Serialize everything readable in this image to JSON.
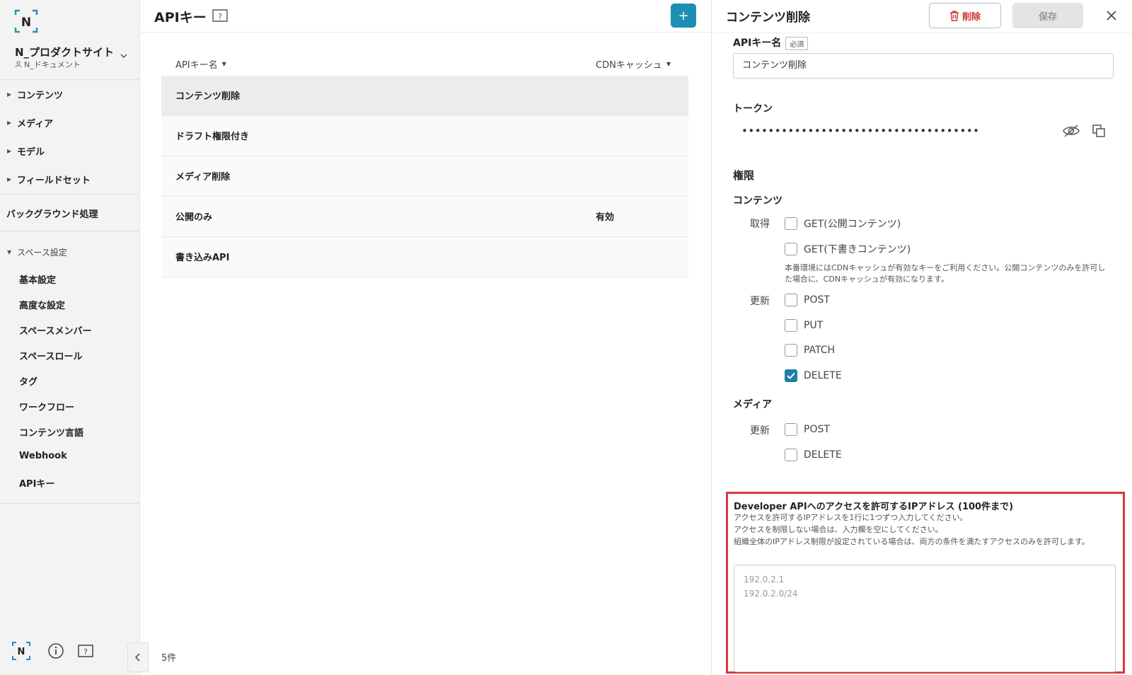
{
  "sidebar": {
    "logo_letter": "N",
    "space_name": "N_プロダクトサイト",
    "space_sub": "N_ドキュメント",
    "nav": [
      {
        "label": "コンテンツ"
      },
      {
        "label": "メディア"
      },
      {
        "label": "モデル"
      },
      {
        "label": "フィールドセット"
      }
    ],
    "background": "バックグラウンド処理",
    "settings_section": "スペース設定",
    "settings": [
      {
        "label": "基本設定"
      },
      {
        "label": "高度な設定"
      },
      {
        "label": "スペースメンバー"
      },
      {
        "label": "スペースロール"
      },
      {
        "label": "タグ"
      },
      {
        "label": "ワークフロー"
      },
      {
        "label": "コンテンツ言語"
      },
      {
        "label": "Webhook"
      },
      {
        "label": "APIキー"
      }
    ]
  },
  "main": {
    "title": "APIキー",
    "add_label": "+",
    "columns": {
      "name": "APIキー名",
      "cdn": "CDNキャッシュ"
    },
    "rows": [
      {
        "name": "コンテンツ削除",
        "cdn": ""
      },
      {
        "name": "ドラフト権限付き",
        "cdn": ""
      },
      {
        "name": "メディア削除",
        "cdn": ""
      },
      {
        "name": "公開のみ",
        "cdn": "有効"
      },
      {
        "name": "書き込みAPI",
        "cdn": ""
      }
    ],
    "count": "5件"
  },
  "panel": {
    "title": "コンテンツ削除",
    "delete_label": "削除",
    "save_label": "保存",
    "name_label": "APIキー名",
    "required_badge": "必須",
    "name_value": "コンテンツ削除",
    "token_label": "トークン",
    "token_value": "••••••••••••••••••••••••••••••••••••",
    "permissions_label": "権限",
    "content_label": "コンテンツ",
    "get_label": "取得",
    "get_public": "GET(公開コンテンツ)",
    "get_draft": "GET(下書きコンテンツ)",
    "note": "本番環境にはCDNキャッシュが有効なキーをご利用ください。公開コンテンツのみを許可した場合に、CDNキャッシュが有効になります。",
    "update_label": "更新",
    "content_updates": [
      {
        "label": "POST",
        "checked": false
      },
      {
        "label": "PUT",
        "checked": false
      },
      {
        "label": "PATCH",
        "checked": false
      },
      {
        "label": "DELETE",
        "checked": true
      }
    ],
    "media_label": "メディア",
    "media_update_label": "更新",
    "media_updates": [
      {
        "label": "POST",
        "checked": false
      },
      {
        "label": "DELETE",
        "checked": false
      }
    ],
    "ip": {
      "title": "Developer APIへのアクセスを許可するIPアドレス (100件まで)",
      "desc1": "アクセスを許可するIPアドレスを1行に1つずつ入力してください。",
      "desc2": "アクセスを制限しない場合は、入力欄を空にしてください。",
      "desc3": "組織全体のIPアドレス制限が設定されている場合は、両方の条件を満たすアクセスのみを許可します。",
      "placeholder1": "192.0.2.1",
      "placeholder2": "192.0.2.0/24"
    }
  },
  "colors": {
    "accent": "#1e8fb4",
    "checkbox_checked": "#1e7ea6",
    "highlight": "#d9383a",
    "danger": "#c9312b"
  }
}
